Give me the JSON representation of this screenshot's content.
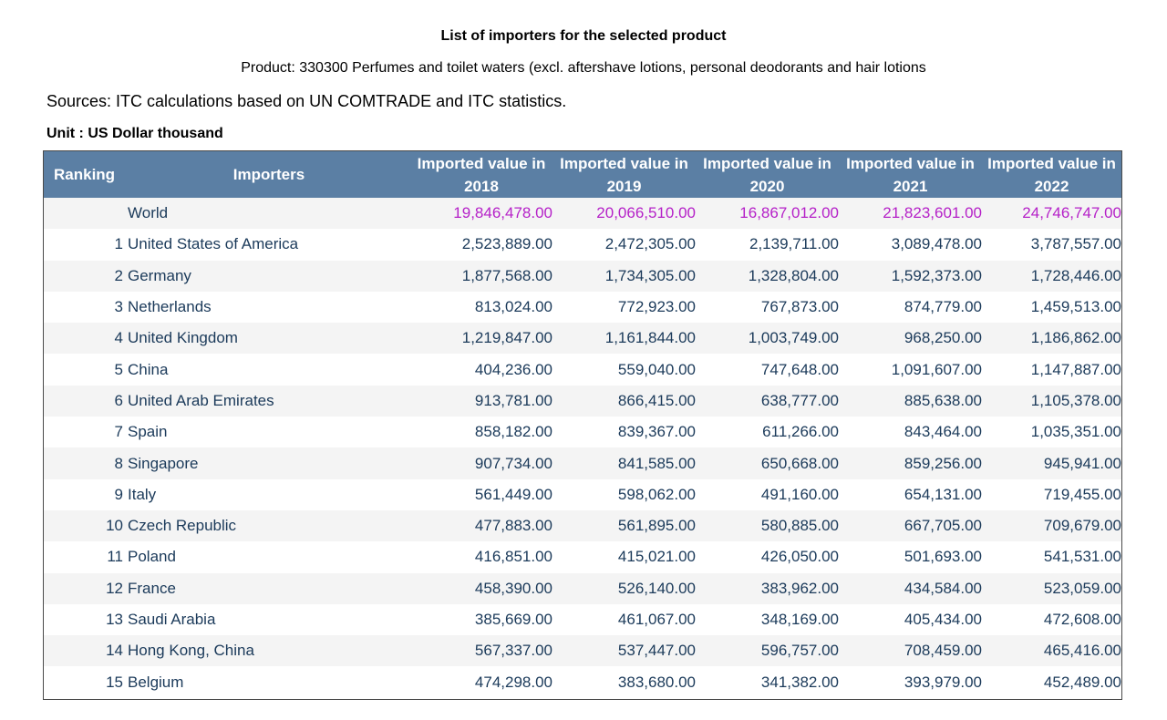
{
  "header": {
    "title": "List of importers for the selected product",
    "product": "Product: 330300 Perfumes and toilet waters (excl. aftershave lotions, personal deodorants and hair lotions",
    "sources": "Sources: ITC calculations based on UN COMTRADE and ITC statistics.",
    "unit": "Unit : US Dollar thousand"
  },
  "table": {
    "columns": {
      "ranking": "Ranking",
      "importers": "Importers",
      "years": [
        {
          "line1": "Imported value in",
          "line2": "2018"
        },
        {
          "line1": "Imported value in",
          "line2": "2019"
        },
        {
          "line1": "Imported value in",
          "line2": "2020"
        },
        {
          "line1": "Imported value in",
          "line2": "2021"
        },
        {
          "line1": "Imported value in",
          "line2": "2022"
        }
      ]
    },
    "rows": [
      {
        "rank": "",
        "name": "World",
        "values": [
          "19,846,478.00",
          "20,066,510.00",
          "16,867,012.00",
          "21,823,601.00",
          "24,746,747.00"
        ]
      },
      {
        "rank": "1",
        "name": "United States of America",
        "values": [
          "2,523,889.00",
          "2,472,305.00",
          "2,139,711.00",
          "3,089,478.00",
          "3,787,557.00"
        ]
      },
      {
        "rank": "2",
        "name": "Germany",
        "values": [
          "1,877,568.00",
          "1,734,305.00",
          "1,328,804.00",
          "1,592,373.00",
          "1,728,446.00"
        ]
      },
      {
        "rank": "3",
        "name": "Netherlands",
        "values": [
          "813,024.00",
          "772,923.00",
          "767,873.00",
          "874,779.00",
          "1,459,513.00"
        ]
      },
      {
        "rank": "4",
        "name": "United Kingdom",
        "values": [
          "1,219,847.00",
          "1,161,844.00",
          "1,003,749.00",
          "968,250.00",
          "1,186,862.00"
        ]
      },
      {
        "rank": "5",
        "name": "China",
        "values": [
          "404,236.00",
          "559,040.00",
          "747,648.00",
          "1,091,607.00",
          "1,147,887.00"
        ]
      },
      {
        "rank": "6",
        "name": "United Arab Emirates",
        "values": [
          "913,781.00",
          "866,415.00",
          "638,777.00",
          "885,638.00",
          "1,105,378.00"
        ]
      },
      {
        "rank": "7",
        "name": "Spain",
        "values": [
          "858,182.00",
          "839,367.00",
          "611,266.00",
          "843,464.00",
          "1,035,351.00"
        ]
      },
      {
        "rank": "8",
        "name": "Singapore",
        "values": [
          "907,734.00",
          "841,585.00",
          "650,668.00",
          "859,256.00",
          "945,941.00"
        ]
      },
      {
        "rank": "9",
        "name": "Italy",
        "values": [
          "561,449.00",
          "598,062.00",
          "491,160.00",
          "654,131.00",
          "719,455.00"
        ]
      },
      {
        "rank": "10",
        "name": "Czech Republic",
        "values": [
          "477,883.00",
          "561,895.00",
          "580,885.00",
          "667,705.00",
          "709,679.00"
        ]
      },
      {
        "rank": "11",
        "name": "Poland",
        "values": [
          "416,851.00",
          "415,021.00",
          "426,050.00",
          "501,693.00",
          "541,531.00"
        ]
      },
      {
        "rank": "12",
        "name": "France",
        "values": [
          "458,390.00",
          "526,140.00",
          "383,962.00",
          "434,584.00",
          "523,059.00"
        ]
      },
      {
        "rank": "13",
        "name": "Saudi Arabia",
        "values": [
          "385,669.00",
          "461,067.00",
          "348,169.00",
          "405,434.00",
          "472,608.00"
        ]
      },
      {
        "rank": "14",
        "name": "Hong Kong, China",
        "values": [
          "567,337.00",
          "537,447.00",
          "596,757.00",
          "708,459.00",
          "465,416.00"
        ]
      },
      {
        "rank": "15",
        "name": "Belgium",
        "values": [
          "474,298.00",
          "383,680.00",
          "341,382.00",
          "393,979.00",
          "452,489.00"
        ]
      }
    ]
  },
  "colors": {
    "header_bg": "#5b7fa4",
    "world_values": "#b521c8",
    "body_text": "#1b3a5a",
    "row_stripe": "#f4f4f4"
  }
}
